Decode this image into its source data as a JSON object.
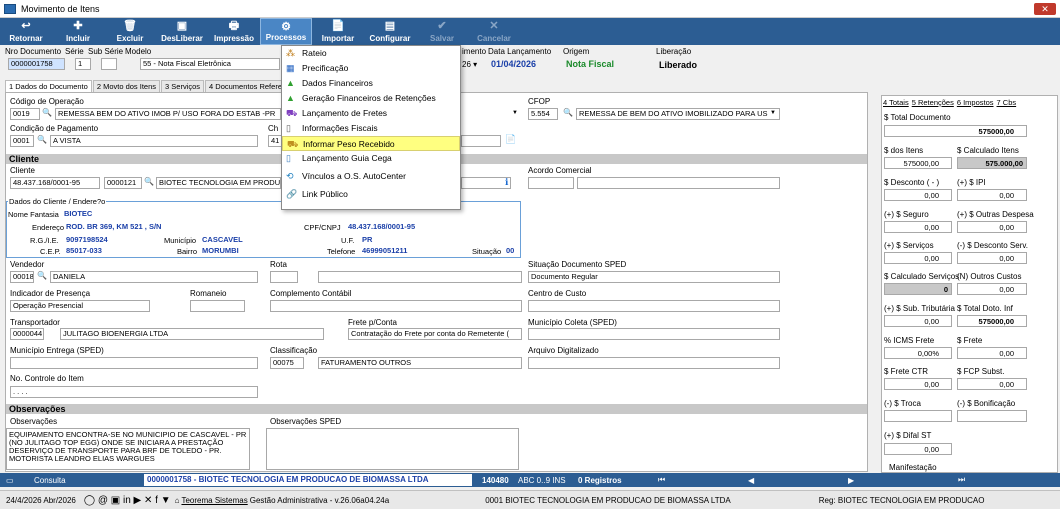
{
  "window": {
    "title": "Movimento de Itens",
    "close": "✕"
  },
  "toolbar": [
    {
      "icon": "↩",
      "label": "Retornar",
      "state": "normal"
    },
    {
      "icon": "✚",
      "label": "Incluir",
      "state": "normal"
    },
    {
      "icon": "🗑",
      "label": "Excluir",
      "state": "normal"
    },
    {
      "icon": "▣",
      "label": "DesLiberar",
      "state": "normal"
    },
    {
      "icon": "🖶",
      "label": "Impressão",
      "state": "normal"
    },
    {
      "icon": "⚙",
      "label": "Processos",
      "state": "active"
    },
    {
      "icon": "📄",
      "label": "Importar",
      "state": "normal"
    },
    {
      "icon": "▤",
      "label": "Configurar",
      "state": "normal"
    },
    {
      "icon": "✔",
      "label": "Salvar",
      "state": "dim"
    },
    {
      "icon": "✕",
      "label": "Cancelar",
      "state": "dim"
    }
  ],
  "header": {
    "nro_documento_label": "Nro Documento",
    "serie_label": "Série",
    "sub_serie_label": "Sub Série",
    "modelo_label": "Modelo",
    "nro_documento": "0000001758",
    "serie": "1",
    "sub_serie": "",
    "modelo": "55 - Nota Fiscal Eletrônica",
    "dt_label": "imento",
    "lanc_label": "Data Lançamento",
    "origem_label": "Origem",
    "liberacao_label": "Liberação",
    "dt_value": "26",
    "lancamento": "01/04/2026",
    "origem": "Nota Fiscal",
    "liberacao": "Liberado"
  },
  "tabs": [
    "1 Dados do Documento",
    "2 Movto dos Itens",
    "3 Serviços",
    "4 Documentos Referen"
  ],
  "form": {
    "codigo_operacao_label": "Código de Operação",
    "codigo_operacao_code": "0019",
    "codigo_operacao": "REMESSA BEM DO ATIVO IMOB P/ USO FORA DO ESTAB -PR",
    "cfop_label": "CFOP",
    "cfop_code": "5.554",
    "cfop": "REMESSA DE BEM DO ATIVO IMOBILIZADO PARA US",
    "condicao_label": "Condição de Pagamento",
    "condicao_code": "0001",
    "condicao": "A VISTA",
    "ch_label": "Ch",
    "ch_value": "41",
    "cliente_section": "Cliente",
    "cliente_label": "Cliente",
    "cliente_cnpj": "48.437.168/0001-95",
    "cliente_code": "0000121",
    "cliente_nome": "BIOTEC TECNOLOGIA EM PRODUC",
    "acordo_label": "Acordo Comercial",
    "dados_cliente_label": "Dados do Cliente / Endere?o",
    "nome_fantasia_label": "Nome Fantasia",
    "nome_fantasia": "BIOTEC",
    "endereco_label": "Endereço",
    "endereco": "ROD. BR 369, KM 521  , S/N",
    "cpf_label": "CPF/CNPJ",
    "cpf": "48.437.168/0001-95",
    "rg_label": "R.G./I.E.",
    "rg": "9097198524",
    "municipio_label": "Município",
    "municipio": "CASCAVEL",
    "uf_label": "U.F.",
    "uf": "PR",
    "cep_label": "C.E.P.",
    "cep": "85017-033",
    "bairro_label": "Bairro",
    "bairro": "MORUMBI",
    "telefone_label": "Telefone",
    "telefone": "46999051211",
    "situacao_label": "Situação",
    "situacao": "00",
    "vendedor_label": "Vendedor",
    "vendedor_code": "00018",
    "vendedor": "DANIELA",
    "rota_label": "Rota",
    "situacao_sped_label": "Situação Documento SPED",
    "situacao_sped": "Documento Regular",
    "indicador_label": "Indicador de Presença",
    "indicador": "Operação Presencial",
    "romaneio_label": "Romaneio",
    "complemento_label": "Complemento Contábil",
    "centro_custo_label": "Centro de Custo",
    "transportador_label": "Transportador",
    "transportador_code": "0000044",
    "transportador": "JULITAGO BIOENERGIA LTDA",
    "frete_label": "Frete p/Conta",
    "frete": "Contratação do Frete por conta do Remetente (",
    "municipio_coleta_label": "Município Coleta (SPED)",
    "municipio_entrega_label": "Município Entrega (SPED)",
    "classificacao_label": "Classificação",
    "classificacao_code": "00075",
    "classificacao": "FATURAMENTO OUTROS",
    "arquivo_label": "Arquivo Digitalizado",
    "controle_label": "No. Controle do Item",
    "controle": " .  .  .  .",
    "obs_section": "Observações",
    "obs_label": "Observações",
    "obs_sped_label": "Observações SPED",
    "obs_text": "EQUIPAMENTO ENCONTRA-SE NO MUNICIPIO DE CASCAVEL - PR (NO JULITAGO TOP EGG) ONDE SE INICIARA A PRESTAÇÃO DESERVIÇO DE TRANSPORTE PARA BRF DE TOLEDO - PR. MOTORISTA LEANDRO ELIAS WARGUES"
  },
  "menu": [
    {
      "icon": "⁂",
      "label": "Rateio",
      "color": "#c08020"
    },
    {
      "icon": "▦",
      "label": "Precificação",
      "color": "#2060c0"
    },
    {
      "icon": "▲",
      "label": "Dados Financeiros",
      "color": "#30a030"
    },
    {
      "icon": "▲",
      "label": "Geração Financeiros de Retenções",
      "color": "#30a030"
    },
    {
      "icon": "⛟",
      "label": "Lançamento de Fretes",
      "color": "#8040c0"
    },
    {
      "icon": "▯",
      "label": "Informações Fiscais",
      "color": "#606060"
    },
    {
      "icon": "⛟",
      "label": "Informar Peso Recebido",
      "color": "#c09020"
    },
    {
      "icon": "▯",
      "label": "Lançamento Guia Cega",
      "color": "#4080c0"
    },
    {
      "icon": "⟲",
      "label": "Vínculos a O.S. AutoCenter",
      "color": "#2080c0"
    },
    {
      "icon": "🔗",
      "label": "Link Público",
      "color": "#2060c0"
    }
  ],
  "right_tabs": [
    "4 Totais",
    "5 Retenções",
    "6 Impostos",
    "7 Cbs"
  ],
  "totals": {
    "total_doc_label": "$ Total Documento",
    "total_doc": "575000,00",
    "dos_itens_label": "$ dos Itens",
    "dos_itens": "575000,00",
    "calc_itens_label": "$ Calculado Itens",
    "calc_itens": "575.000,00",
    "desconto_label": "$ Desconto ( - )",
    "desconto": "0,00",
    "ipi_label": "(+) $ IPI",
    "ipi": "0,00",
    "seguro_label": "(+) $ Seguro",
    "seguro": "0,00",
    "outras_label": "(+) $ Outras Despesa",
    "outras": "0,00",
    "servicos_label": "(+) $ Serviços",
    "servicos": "0,00",
    "desc_serv_label": "(-) $ Desconto Serv.",
    "desc_serv": "0,00",
    "calc_serv_label": "$ Calculado Serviços",
    "calc_serv": "0",
    "outros_custos_label": "(N) Outros Custos",
    "outros_custos": "0,00",
    "sub_trib_label": "(+) $ Sub. Tributária",
    "sub_trib": "0,00",
    "total_doto_label": "$ Total Doto. Inf",
    "total_doto": "575000,00",
    "icms_frete_label": "% ICMS Frete",
    "icms_frete": "0,00%",
    "frete_label": "$ Frete",
    "frete": "0,00",
    "frete_ctr_label": "$ Frete CTR",
    "frete_ctr": "0,00",
    "fcp_label": "$ FCP Subst.",
    "fcp": "0,00",
    "troca_label": "(-) $ Troca",
    "bonificacao_label": "(-) $ Bonificação",
    "difal_label": "(+) $ Difal ST",
    "difal": "0,00",
    "manifest_label": "Manifestação"
  },
  "status": {
    "consulta": "Consulta",
    "doc": "0000001758 - BIOTEC TECNOLOGIA EM PRODUCAO DE BIOMASSA LTDA",
    "code": "140480",
    "abc": "ABC 0..9 INS",
    "registros": "0 Registros"
  },
  "bottom": {
    "date": "24/4/2026 Abr/2026",
    "company_link": "Teorema Sistemas",
    "app": "Gestão Administrativa - v.26.06a04.24a",
    "empresa": "0001 BIOTEC TECNOLOGIA EM PRODUCAO DE BIOMASSA LTDA",
    "reg": "Reg: BIOTEC TECNOLOGIA EM PRODUCAO"
  }
}
